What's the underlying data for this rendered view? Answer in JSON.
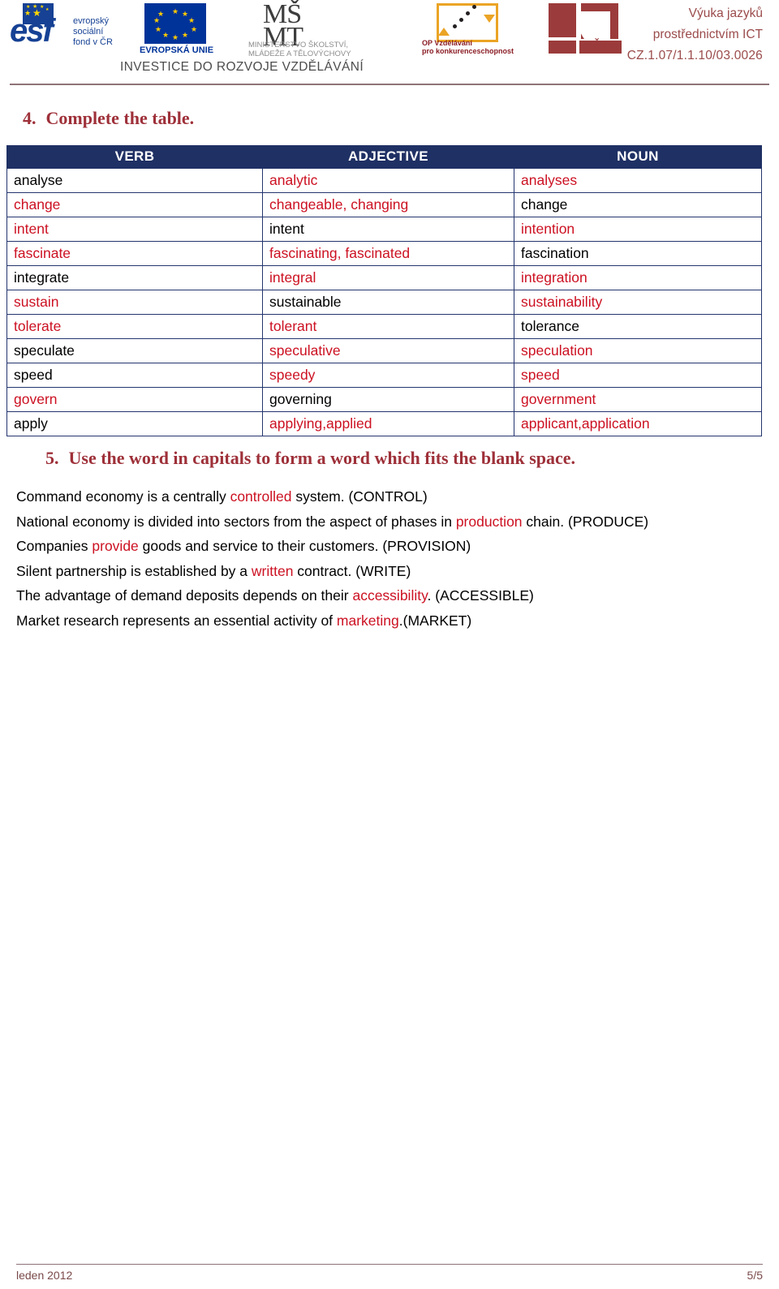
{
  "header": {
    "logos": [
      {
        "name": "esf-logo",
        "wordmark": "esf",
        "lines": [
          "evropský",
          "sociální",
          "fond v ČR"
        ]
      },
      {
        "name": "eu-flag-logo",
        "caption": "EVROPSKÁ UNIE"
      },
      {
        "name": "msmt-logo",
        "mark_top": "MŠ",
        "mark_bottom": "MT",
        "caption_line1": "MINISTERSTVO ŠKOLSTVÍ,",
        "caption_line2": "MLÁDEŽE A TĚLOVÝCHOVY"
      },
      {
        "name": "op-vzdelavani-logo",
        "caption_line1": "OP Vzdělávání",
        "caption_line2": "pro konkurenceschopnost"
      },
      {
        "name": "vste-logo",
        "wordmark": "VŠTE"
      }
    ],
    "investment_line": "INVESTICE DO ROZVOJE VZDĚLÁVÁNÍ",
    "project_title_line1": "Výuka jazyků",
    "project_title_line2": "prostřednictvím ICT",
    "project_id": "CZ.1.07/1.1.10/03.0026",
    "accent_color": "#9b4b4b",
    "rule_color": "#8e7278"
  },
  "task4": {
    "number": "4.",
    "title": "Complete the table.",
    "heading_color": "#9e3039",
    "table": {
      "header_bg": "#1f3064",
      "answer_color": "#cc1122",
      "columns": [
        "VERB",
        "ADJECTIVE",
        "NOUN"
      ],
      "rows": [
        {
          "verb": "analyse",
          "verb_answer": false,
          "adjective": "analytic",
          "adjective_answer": true,
          "noun": "analyses",
          "noun_answer": true
        },
        {
          "verb": "change",
          "verb_answer": true,
          "adjective": "changeable, changing",
          "adjective_answer": true,
          "noun": "change",
          "noun_answer": false
        },
        {
          "verb": "intent",
          "verb_answer": true,
          "adjective": "intent",
          "adjective_answer": false,
          "noun": "intention",
          "noun_answer": true
        },
        {
          "verb": "fascinate",
          "verb_answer": true,
          "adjective": "fascinating, fascinated",
          "adjective_answer": true,
          "noun": "fascination",
          "noun_answer": false
        },
        {
          "verb": "integrate",
          "verb_answer": false,
          "adjective": "integral",
          "adjective_answer": true,
          "noun": "integration",
          "noun_answer": true
        },
        {
          "verb": "sustain",
          "verb_answer": true,
          "adjective": "sustainable",
          "adjective_answer": false,
          "noun": "sustainability",
          "noun_answer": true
        },
        {
          "verb": "tolerate",
          "verb_answer": true,
          "adjective": "tolerant",
          "adjective_answer": true,
          "noun": "tolerance",
          "noun_answer": false
        },
        {
          "verb": "speculate",
          "verb_answer": false,
          "adjective": "speculative",
          "adjective_answer": true,
          "noun": "speculation",
          "noun_answer": true
        },
        {
          "verb": "speed",
          "verb_answer": false,
          "adjective": "speedy",
          "adjective_answer": true,
          "noun": "speed",
          "noun_answer": true
        },
        {
          "verb": "govern",
          "verb_answer": true,
          "adjective": "governing",
          "adjective_answer": false,
          "noun": "government",
          "noun_answer": true
        },
        {
          "verb": "apply",
          "verb_answer": false,
          "adjective": "applying,applied",
          "adjective_answer": true,
          "noun": "applicant,application",
          "noun_answer": true
        }
      ]
    }
  },
  "task5": {
    "number": "5.",
    "title": "Use the word in capitals to form a word which fits the blank space.",
    "heading_color": "#9e3039",
    "answer_color": "#cc1122",
    "items": [
      {
        "before": "Command economy is a centrally ",
        "answer": "controlled",
        "after": " system. (CONTROL)"
      },
      {
        "before": "National economy is divided into sectors from the aspect of phases in ",
        "answer": "production",
        "after": " chain. (PRODUCE)"
      },
      {
        "before": "Companies ",
        "answer": "provide",
        "after": " goods and service to their customers. (PROVISION)"
      },
      {
        "before": "Silent partnership is established by a ",
        "answer": "written",
        "after": " contract. (WRITE)"
      },
      {
        "before": "The advantage of demand deposits depends on their ",
        "answer": "accessibility",
        "after": ". (ACCESSIBLE)"
      },
      {
        "before": "Market research represents an essential activity of ",
        "answer": "marketing",
        "after": ".(MARKET)"
      }
    ]
  },
  "footer": {
    "date": "leden 2012",
    "page": "5/5",
    "color": "#7a4a4a"
  }
}
